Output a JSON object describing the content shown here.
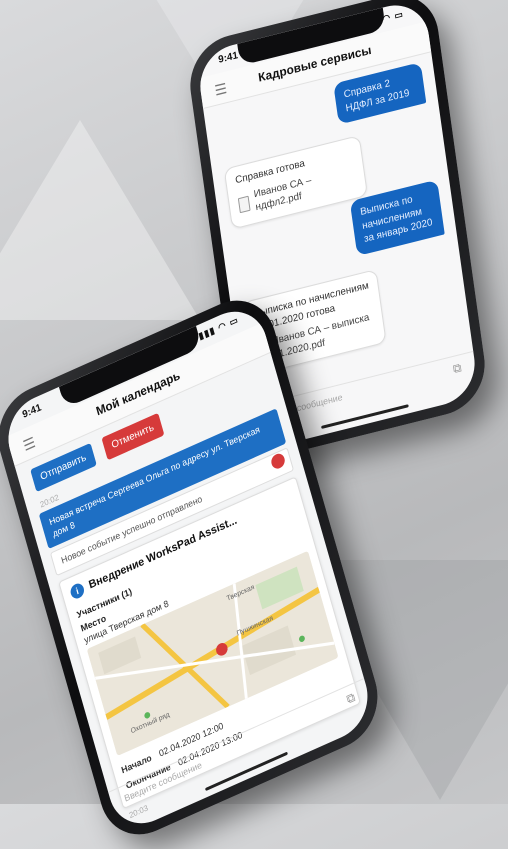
{
  "phone_back": {
    "status_time": "9:41",
    "app_title": "Кадровые сервисы",
    "messages": [
      {
        "dir": "out",
        "text": "Справка 2 НДФЛ за 2019"
      },
      {
        "dir": "in",
        "text": "Справка готова",
        "file": "Иванов СА – ндфл2.pdf"
      },
      {
        "dir": "out",
        "text": "Выписка по начислениям за январь 2020"
      },
      {
        "dir": "in",
        "text": "Выписка по начислениям за 01.2020 готова",
        "file": "Иванов СА – выписка 01.2020.pdf"
      }
    ],
    "input_placeholder": "Введите сообщение"
  },
  "phone_front": {
    "status_time": "9:41",
    "app_title": "Мой календарь",
    "send_label": "Отправить",
    "cancel_label": "Отменить",
    "timestamp": "20:02",
    "banner_text": "Новая встреча Сергеева Ольга по адресу ул. Тверская дом 8",
    "info_text": "Новое событие успешно отправлено",
    "event_title": "Внедрение WorksPad Assist...",
    "participants_label": "Участники (1)",
    "place_label": "Место",
    "place_value": "улица Тверская дом 8",
    "start_label": "Начало",
    "start_value": "02.04.2020 12:00",
    "end_label": "Окончание",
    "end_value": "02.04.2020 13:00",
    "timestamp2": "20:03",
    "input_placeholder": "Введите сообщение",
    "map_labels": [
      "Тверская",
      "Пушкинская",
      "Охотный ряд"
    ],
    "accent_blue": "#1e6fc4",
    "accent_red": "#d63a3a"
  }
}
